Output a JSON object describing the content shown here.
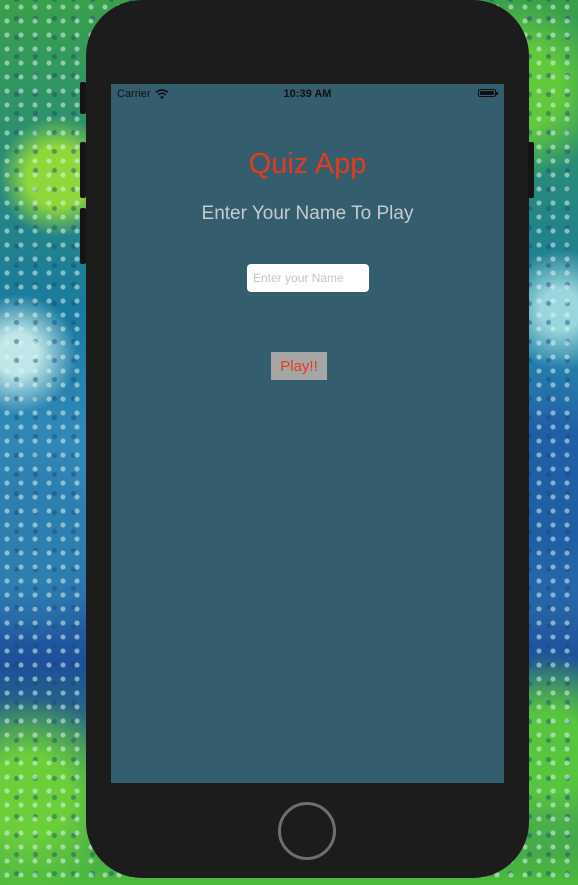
{
  "status_bar": {
    "carrier": "Carrier",
    "time": "10:39 AM",
    "wifi_icon": "wifi-icon",
    "battery_icon": "battery-icon"
  },
  "app": {
    "title": "Quiz App",
    "subtitle": "Enter Your Name To Play",
    "name_input": {
      "value": "",
      "placeholder": "Enter your Name"
    },
    "play_button_label": "Play!!"
  },
  "colors": {
    "screen_background": "#345d6d",
    "title_color": "#e53a1e",
    "subtitle_color": "#c6cbcf",
    "button_background": "#a6a6a6"
  }
}
